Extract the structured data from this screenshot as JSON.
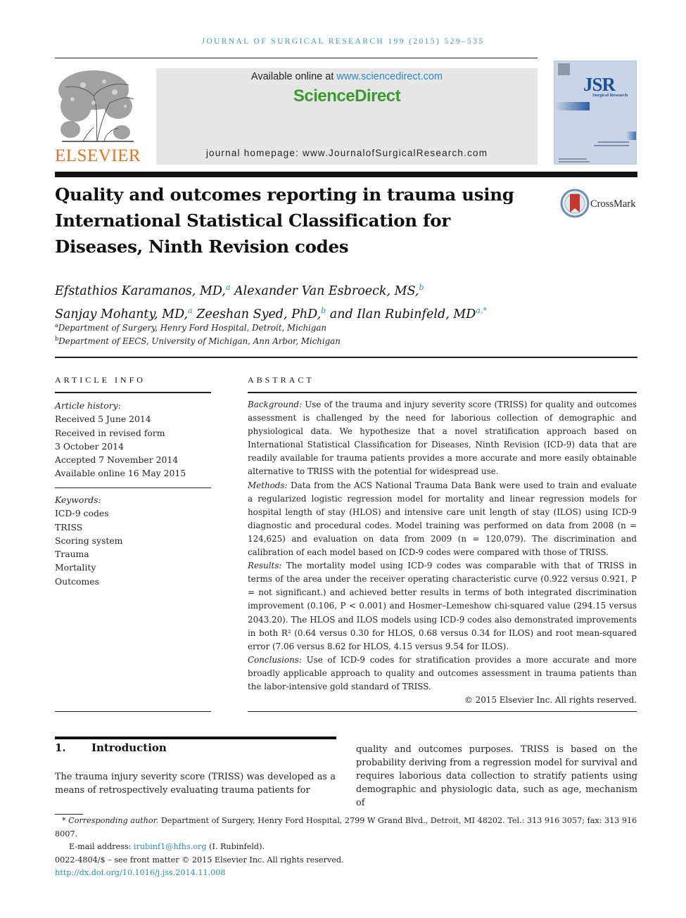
{
  "running_head": "Journal of Surgical Research 199 (2015) 529–535",
  "publisher": {
    "logo_text": "ELSEVIER",
    "available_prefix": "Available online at ",
    "available_link": "www.sciencedirect.com",
    "platform": "ScienceDirect",
    "homepage": "journal homepage: www.JournalofSurgicalResearch.com"
  },
  "cover": {
    "journal_abbrev": "JSR",
    "journal_name": "Surgical Research"
  },
  "crossmark": {
    "label": "CrossMark"
  },
  "title": "Quality and outcomes reporting in trauma using International Statistical Classification for Diseases, Ninth Revision codes",
  "authors": [
    {
      "name": "Efstathios Karamanos, MD,",
      "aff": "a"
    },
    {
      "name": "Alexander Van Esbroeck, MS,",
      "aff": "b"
    },
    {
      "name": "Sanjay Mohanty, MD,",
      "aff": "a"
    },
    {
      "name": "Zeeshan Syed, PhD,",
      "aff": "b"
    },
    {
      "name": "and Ilan Rubinfeld, MD",
      "aff": "a,*"
    }
  ],
  "affiliations": [
    {
      "key": "a",
      "text": "Department of Surgery, Henry Ford Hospital, Detroit, Michigan"
    },
    {
      "key": "b",
      "text": "Department of EECS, University of Michigan, Ann Arbor, Michigan"
    }
  ],
  "article_info": {
    "heading": "ARTICLE INFO",
    "history_label": "Article history:",
    "history": [
      "Received 5 June 2014",
      "Received in revised form",
      "3 October 2014",
      "Accepted 7 November 2014",
      "Available online 16 May 2015"
    ],
    "keywords_label": "Keywords:",
    "keywords": [
      "ICD-9 codes",
      "TRISS",
      "Scoring system",
      "Trauma",
      "Mortality",
      "Outcomes"
    ]
  },
  "abstract": {
    "heading": "ABSTRACT",
    "sections": [
      {
        "label": "Background:",
        "text": " Use of the trauma and injury severity score (TRISS) for quality and outcomes assessment is challenged by the need for laborious collection of demographic and physiological data. We hypothesize that a novel stratification approach based on International Statistical Classification for Diseases, Ninth Revision (ICD-9) data that are readily available for trauma patients provides a more accurate and more easily obtainable alternative to TRISS with the potential for widespread use."
      },
      {
        "label": "Methods:",
        "text": " Data from the ACS National Trauma Data Bank were used to train and evaluate a regularized logistic regression model for mortality and linear regression models for hospital length of stay (HLOS) and intensive care unit length of stay (ILOS) using ICD-9 diagnostic and procedural codes. Model training was performed on data from 2008 (n = 124,625) and evaluation on data from 2009 (n = 120,079). The discrimination and calibration of each model based on ICD-9 codes were compared with those of TRISS."
      },
      {
        "label": "Results:",
        "text": " The mortality model using ICD-9 codes was comparable with that of TRISS in terms of the area under the receiver operating characteristic curve (0.922 versus 0.921, P = not significant.) and achieved better results in terms of both integrated discrimination improvement (0.106, P < 0.001) and Hosmer–Lemeshow chi-squared value (294.15 versus 2043.20). The HLOS and ILOS models using ICD-9 codes also demonstrated improvements in both R² (0.64 versus 0.30 for HLOS, 0.68 versus 0.34 for ILOS) and root mean-squared error (7.06 versus 8.62 for HLOS, 4.15 versus 9.54 for ILOS)."
      },
      {
        "label": "Conclusions:",
        "text": " Use of ICD-9 codes for stratification provides a more accurate and more broadly applicable approach to quality and outcomes assessment in trauma patients than the labor-intensive gold standard of TRISS."
      }
    ],
    "copyright": "© 2015 Elsevier Inc. All rights reserved."
  },
  "introduction": {
    "number": "1.",
    "heading": "Introduction",
    "col1": "The trauma injury severity score (TRISS) was developed as a means of retrospectively evaluating trauma patients for",
    "col2": "quality and outcomes purposes. TRISS is based on the probability deriving from a regression model for survival and requires laborious data collection to stratify patients using demographic and physiologic data, such as age, mechanism of"
  },
  "footnotes": {
    "corresponding_label": "Corresponding author.",
    "corresponding_text": " Department of Surgery, Henry Ford Hospital, 2799 W Grand Blvd., Detroit, MI 48202. Tel.: 313 916 3057; fax: 313 916 8007.",
    "email_label": "E-mail address: ",
    "email": "irubinf1@hfhs.org",
    "email_suffix": " (I. Rubinfeld).",
    "issn_line": "0022-4804/$ – see front matter © 2015 Elsevier Inc. All rights reserved.",
    "doi": "http://dx.doi.org/10.1016/j.jss.2014.11.008"
  }
}
